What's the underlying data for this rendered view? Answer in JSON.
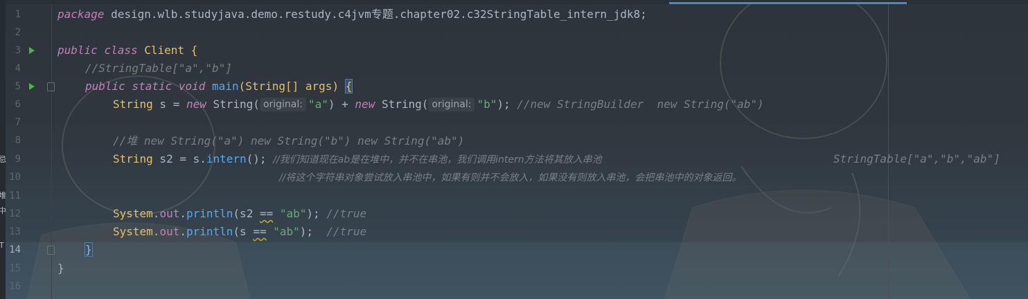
{
  "editor": {
    "line_numbers": [
      "1",
      "2",
      "3",
      "4",
      "5",
      "6",
      "7",
      "8",
      "9",
      "10",
      "11",
      "12",
      "13",
      "14",
      "15",
      "16"
    ],
    "lines": {
      "l1": {
        "kw": "package",
        "text": " design.wlb.studyjava.demo.restudy.c4jvm专题.chapter02.c32StringTable_intern_jdk8;"
      },
      "l3": {
        "kw1": "public",
        "kw2": "class",
        "name": " Client {"
      },
      "l4": {
        "comment": "//StringTable[\"a\",\"b\"]"
      },
      "l5": {
        "kw1": "public",
        "kw2": "static",
        "kw3": "void",
        "fn": "main",
        "rest1": "(String[] args) ",
        "brace": "{"
      },
      "l6": {
        "type": "String",
        "rest1": " s = ",
        "kw_new1": "new",
        "ctor1": " String(",
        "hint1": "original:",
        "str1": "\"a\"",
        "rest2": ") + ",
        "kw_new2": "new",
        "ctor2": " String(",
        "hint2": "original:",
        "str2": "\"b\"",
        "rest3": "); ",
        "comment": "//new StringBuilder  new String(\"ab\")"
      },
      "l8": {
        "comment": "//堆 new String(\"a\") new String(\"b\") new String(\"ab\")"
      },
      "l9": {
        "type": "String",
        "rest1": " s2 = s.",
        "fn": "intern",
        "rest2": "(); ",
        "comment": "//我们知道现在ab是在堆中，并不在串池，我们调用intern方法将其放入串池",
        "comment_right": "StringTable[\"a\",\"b\",\"ab\"]"
      },
      "l10": {
        "comment": "//将这个字符串对象尝试放入串池中，如果有则并不会放入，如果没有则放入串池，会把串池中的对象返回。"
      },
      "l12": {
        "cls": "System",
        "dot1": ".",
        "field": "out",
        "dot2": ".",
        "fn": "println",
        "rest1": "(s2 ",
        "op": "==",
        "rest2": " ",
        "str": "\"ab\"",
        "rest3": "); ",
        "comment": "//true"
      },
      "l13": {
        "cls": "System",
        "dot1": ".",
        "field": "out",
        "dot2": ".",
        "fn": "println",
        "rest1": "(s ",
        "op": "==",
        "rest2": " ",
        "str": "\"ab\"",
        "rest3": ");  ",
        "comment": "//true"
      },
      "l14": {
        "brace": "}"
      },
      "l15": {
        "brace": "}"
      }
    },
    "side_glyphs": [
      "忌",
      "堆",
      "中",
      "T"
    ]
  },
  "colors": {
    "background": "#2e343b",
    "keyword": "#c77dbb",
    "string": "#6aab73",
    "comment": "#7a7e85",
    "function": "#56a8f5",
    "class": "#e8bf6a",
    "run_icon": "#4fb34f",
    "active_tab": "#4a88c7"
  }
}
